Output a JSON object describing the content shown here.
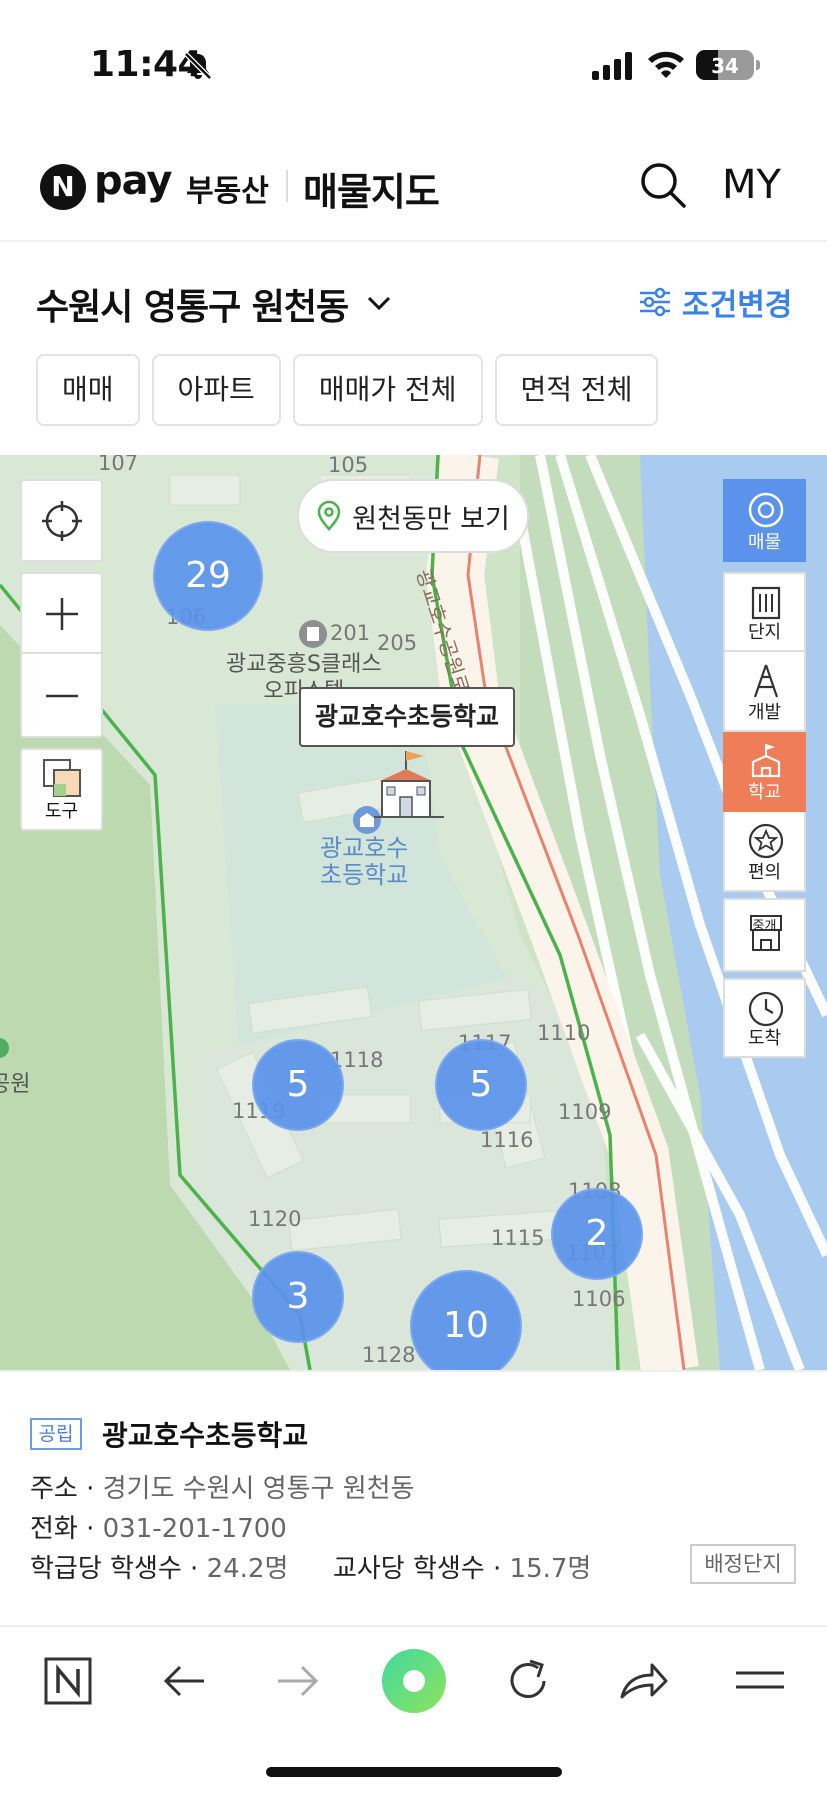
{
  "status_bar": {
    "time": "11:44",
    "battery": "34"
  },
  "header": {
    "logo_letter": "N",
    "pay": "pay",
    "service": "부동산",
    "title": "매물지도",
    "my": "MY"
  },
  "location": {
    "text": "수원시 영통구 원천동",
    "condition_label": "조건변경"
  },
  "filters": [
    "매매",
    "아파트",
    "매매가 전체",
    "면적 전체"
  ],
  "map": {
    "only_button": "원천동만 보기",
    "tooltip": "광교호수초등학교",
    "tool_label": "도구",
    "poi_building": [
      "광교중흥S클래스",
      "오피스텔"
    ],
    "poi_school": [
      "광교호수",
      "초등학교"
    ],
    "poi_park": "공원",
    "road": "광교호수공원로",
    "building_numbers": [
      "107",
      "105",
      "106",
      "201",
      "205",
      "1118",
      "1117",
      "1110",
      "1119",
      "1116",
      "1109",
      "1108",
      "1120",
      "1115",
      "1107",
      "1106",
      "1128"
    ],
    "clusters": [
      "29",
      "5",
      "5",
      "2",
      "3",
      "10"
    ],
    "side_buttons": [
      "매물",
      "단지",
      "개발",
      "학교",
      "편의",
      "중개",
      "도착"
    ],
    "broker_icon_text": "중개"
  },
  "info": {
    "badge": "공립",
    "name": "광교호수초등학교",
    "address_label": "주소 ·",
    "address": "경기도 수원시 영통구 원천동",
    "phone_label": "전화 ·",
    "phone": "031-201-1700",
    "per_class_label": "학급당 학생수 ·",
    "per_class": "24.2명",
    "per_teacher_label": "교사당 학생수 ·",
    "per_teacher": "15.7명",
    "assign_button": "배정단지"
  },
  "colors": {
    "accent": "#3b82e8",
    "school_active": "#ef7d57",
    "cluster": "#5a92ec"
  }
}
